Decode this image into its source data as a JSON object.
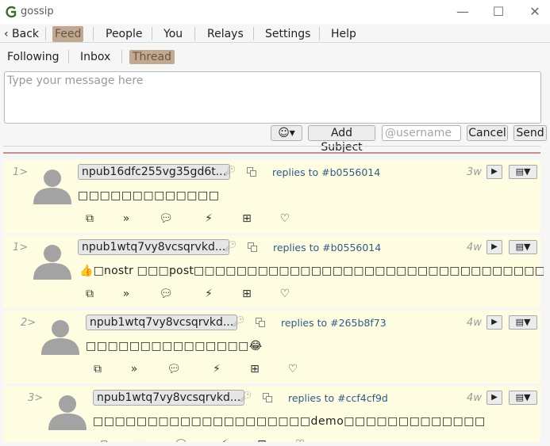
{
  "window": {
    "title": "gossip"
  },
  "main_menu": {
    "back": "‹ Back",
    "items": [
      "Feed",
      "People",
      "You",
      "Relays",
      "Settings",
      "Help"
    ]
  },
  "feed_tabs": [
    "Following",
    "Inbox",
    "Thread"
  ],
  "composer": {
    "placeholder": "Type your message here",
    "emoji_button": "☺▾",
    "add_subject": "Add Subject",
    "username_placeholder": "@username",
    "cancel": "Cancel",
    "send": "Send"
  },
  "notes": [
    {
      "depth": "1>",
      "author": "npub16dfc255vg35gd6t...",
      "replies_to": "replies to #b0556014",
      "age": "3w",
      "content": "□□□□□□□□□□□□□"
    },
    {
      "depth": "1>",
      "author": "npub1wtq7vy8vcsqrvkd...",
      "replies_to": "replies to #b0556014",
      "age": "4w",
      "content": "👍□nostr □□□post□□□□□□□□□□□□□□□□□□□□□□□□□□□□□□□□□□□"
    },
    {
      "depth": "2>",
      "author": "npub1wtq7vy8vcsqrvkd...",
      "replies_to": "replies to #265b8f73",
      "age": "4w",
      "content": "□□□□□□□□□□□□□□□😂"
    },
    {
      "depth": "3>",
      "author": "npub1wtq7vy8vcsqrvkd...",
      "replies_to": "replies to #ccf4cf9d",
      "age": "4w",
      "content": "□□□□□□□□□□□□□□□□□□□□demo□□□□□□□□□□□□□"
    }
  ],
  "icons": {
    "app": "gossip-logo-icon",
    "key": "key-icon",
    "copy": "copy-icon",
    "repost": "repost-icon",
    "quote": "quote-icon",
    "reply": "reply-icon",
    "zap": "zap-icon",
    "reaction": "reaction-icon",
    "like": "heart-icon"
  },
  "colors": {
    "active_tab_bg": "#c1a991",
    "note_bg": "#fffde1",
    "reply_link": "#2e5c86",
    "divider": "#c4928e"
  }
}
